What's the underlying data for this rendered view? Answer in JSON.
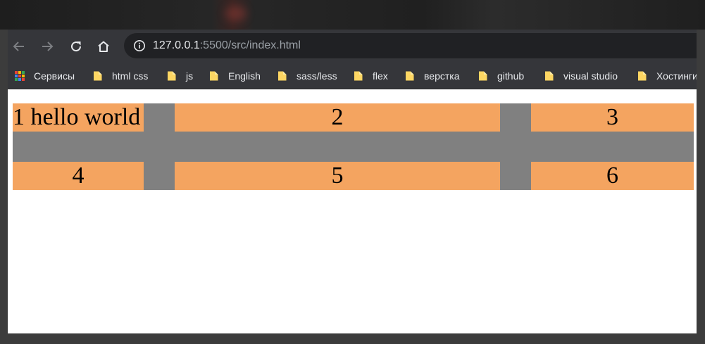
{
  "browser": {
    "url_host": "127.0.0.1",
    "url_rest": ":5500/src/index.html"
  },
  "bookmarks": [
    {
      "label": "Сервисы",
      "icon": "apps-grid-icon"
    },
    {
      "label": "html css",
      "icon": "folder-icon"
    },
    {
      "label": "js",
      "icon": "folder-icon"
    },
    {
      "label": "English",
      "icon": "folder-icon"
    },
    {
      "label": "sass/less",
      "icon": "folder-icon"
    },
    {
      "label": "flex",
      "icon": "folder-icon"
    },
    {
      "label": "верстка",
      "icon": "folder-icon"
    },
    {
      "label": "github",
      "icon": "folder-icon"
    },
    {
      "label": "visual studio",
      "icon": "folder-icon"
    },
    {
      "label": "Хостинги",
      "icon": "folder-icon"
    }
  ],
  "grid": {
    "items": [
      "1 hello world",
      "2",
      "3",
      "4",
      "5",
      "6"
    ],
    "colors": {
      "item": "#f4a460",
      "gap": "#808080"
    }
  }
}
